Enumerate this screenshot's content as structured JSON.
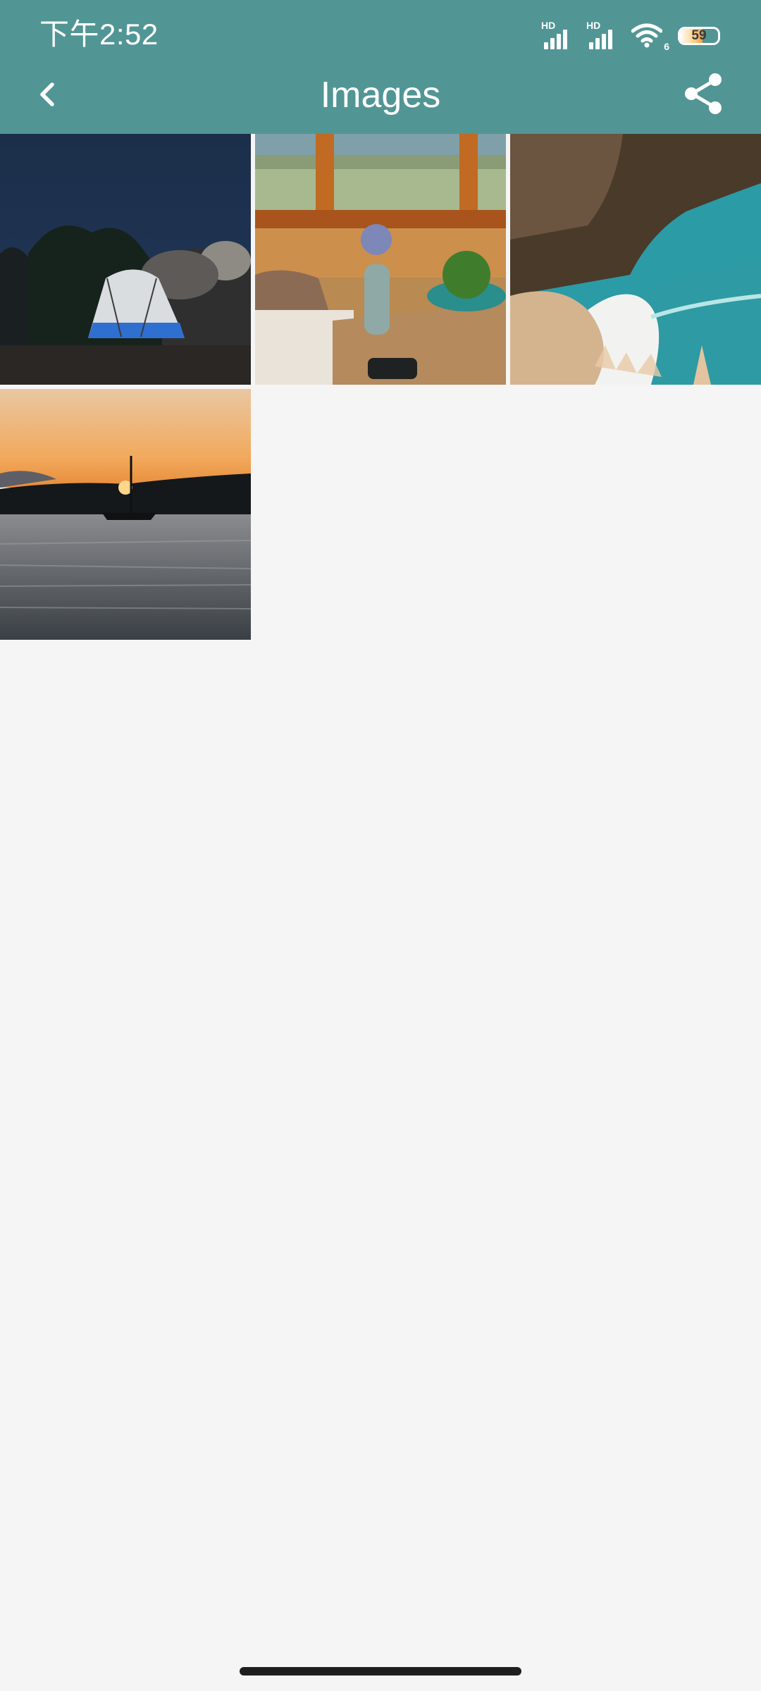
{
  "status_bar": {
    "time": "下午2:52",
    "signal_1_label": "HD",
    "signal_2_label": "HD",
    "wifi_badge": "6",
    "battery_percent": "59",
    "battery_level": 0.59
  },
  "app_bar": {
    "title": "Images",
    "back_icon": "chevron-left-icon",
    "share_icon": "share-icon",
    "background_color": "#529595"
  },
  "images": [
    {
      "name": "tent-at-night"
    },
    {
      "name": "cabin-interior-table"
    },
    {
      "name": "coastal-beach-waterfall"
    },
    {
      "name": "sailboat-sunset-lake"
    }
  ]
}
